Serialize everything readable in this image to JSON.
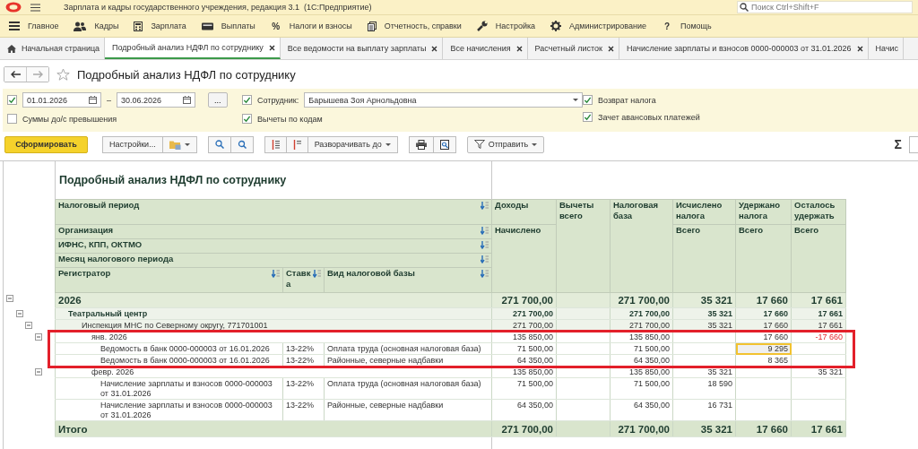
{
  "window": {
    "title": "Зарплата и кадры государственного учреждения, редакция 3.1  (1С:Предприятие)",
    "search_placeholder": "Поиск Ctrl+Shift+F"
  },
  "menu": [
    {
      "label": "Главное",
      "kind": "menu"
    },
    {
      "label": "Кадры",
      "kind": "people"
    },
    {
      "label": "Зарплата",
      "kind": "calculator"
    },
    {
      "label": "Выплаты",
      "kind": "wallet"
    },
    {
      "label": "Налоги и взносы",
      "glyph": "%"
    },
    {
      "label": "Отчетность, справки",
      "kind": "document"
    },
    {
      "label": "Настройка",
      "kind": "wrench"
    },
    {
      "label": "Администрирование",
      "kind": "gear"
    },
    {
      "label": "Помощь",
      "glyph": "?"
    }
  ],
  "tabs": [
    {
      "label": "Начальная страница",
      "kind": "home",
      "selected": false
    },
    {
      "label": "Подробный анализ НДФЛ по сотруднику",
      "kind": "closable",
      "selected": true
    },
    {
      "label": "Все ведомости на выплату зарплаты",
      "kind": "closable",
      "selected": false
    },
    {
      "label": "Все начисления",
      "kind": "closable",
      "selected": false
    },
    {
      "label": "Расчетный листок",
      "kind": "closable",
      "selected": false
    },
    {
      "label": "Начисление зарплаты и взносов 0000-000003 от 31.01.2026",
      "kind": "closable",
      "selected": false
    },
    {
      "label": "Начис",
      "kind": "cut",
      "selected": false
    }
  ],
  "form": {
    "title": "Подробный анализ НДФЛ по сотруднику"
  },
  "filters": {
    "period": {
      "checked": true,
      "date_from": "01.01.2026",
      "separator": "–",
      "date_to": "30.06.2026",
      "button": "..."
    },
    "exceed_sums": {
      "label": "Суммы до/с превышения",
      "checked": false
    },
    "employee": {
      "label": "Сотрудник:",
      "checked": true,
      "value": "Барышева Зоя Арнольдовна"
    },
    "by_codes": {
      "label": "Вычеты по кодам",
      "checked": true
    },
    "refund": {
      "label": "Возврат налога",
      "checked": true
    },
    "advance": {
      "label": "Зачет авансовых платежей",
      "checked": true
    }
  },
  "toolbar": {
    "generate": "Сформировать",
    "settings": "Настройки...",
    "expand": "Разворачивать до",
    "send": "Отправить",
    "sum": "Σ"
  },
  "report": {
    "title": "Подробный анализ НДФЛ по сотруднику",
    "group_levels": [
      "Налоговый период",
      "Организация",
      "ИФНС, КПП, ОКТМО",
      "Месяц налогового периода"
    ],
    "detail_columns": [
      "Регистратор",
      "Ставка",
      "Вид налоговой базы"
    ],
    "value_columns": [
      {
        "label": "Доходы",
        "sub": "Начислено"
      },
      {
        "label": "Вычеты всего"
      },
      {
        "label": "Налоговая база"
      },
      {
        "label": "Исчислено налога",
        "sub": "Всего"
      },
      {
        "label": "Удержано налога",
        "sub": "Всего"
      },
      {
        "label": "Осталось удержать",
        "sub": "Всего"
      }
    ],
    "rows": [
      {
        "kind": "year",
        "label": "2026",
        "expanded": true,
        "values": {
          "income": "271 700,00",
          "base": "271 700,00",
          "calculated": "35 321",
          "withheld": "17 660",
          "remaining": "17 661"
        },
        "children": [
          {
            "kind": "org",
            "label": "Театральный центр",
            "expanded": true,
            "values": {
              "income": "271 700,00",
              "base": "271 700,00",
              "calculated": "35 321",
              "withheld": "17 660",
              "remaining": "17 661"
            },
            "children": [
              {
                "kind": "ifns",
                "label": "Инспекция МНС по Северному округу, 771701001",
                "expanded": true,
                "values": {
                  "income": "271 700,00",
                  "base": "271 700,00",
                  "calculated": "35 321",
                  "withheld": "17 660",
                  "remaining": "17 661"
                },
                "children": [
                  {
                    "kind": "month",
                    "label": "янв. 2026",
                    "expanded": true,
                    "highlight_frame": true,
                    "values": {
                      "income": "135 850,00",
                      "base": "135 850,00",
                      "withheld": "17 660",
                      "remaining": {
                        "text": "-17 660",
                        "negative": true
                      }
                    },
                    "children": [
                      {
                        "kind": "doc",
                        "label": "Ведомость в банк 0000-000003 от 16.01.2026",
                        "rate": "13-22%",
                        "base_type": "Оплата труда (основная налоговая база)",
                        "values": {
                          "income": "71 500,00",
                          "base": "71 500,00",
                          "withheld": {
                            "text": "9 295",
                            "selected": true
                          }
                        }
                      },
                      {
                        "kind": "doc",
                        "label": "Ведомость в банк 0000-000003 от 16.01.2026",
                        "rate": "13-22%",
                        "base_type": "Районные, северные надбавки",
                        "values": {
                          "income": "64 350,00",
                          "base": "64 350,00",
                          "withheld": "8 365"
                        }
                      }
                    ]
                  },
                  {
                    "kind": "month",
                    "label": "февр. 2026",
                    "expanded": true,
                    "values": {
                      "income": "135 850,00",
                      "base": "135 850,00",
                      "calculated": "35 321",
                      "remaining": "35 321"
                    },
                    "children": [
                      {
                        "kind": "doc",
                        "label": "Начисление зарплаты и взносов 0000-000003 от 31.01.2026",
                        "rate": "13-22%",
                        "base_type": "Оплата труда (основная налоговая база)",
                        "values": {
                          "income": "71 500,00",
                          "base": "71 500,00",
                          "calculated": "18 590"
                        }
                      },
                      {
                        "kind": "doc",
                        "label": "Начисление зарплаты и взносов 0000-000003 от 31.01.2026",
                        "rate": "13-22%",
                        "base_type": "Районные, северные надбавки",
                        "values": {
                          "income": "64 350,00",
                          "base": "64 350,00",
                          "calculated": "16 731"
                        }
                      }
                    ]
                  }
                ]
              }
            ]
          }
        ]
      }
    ],
    "total": {
      "label": "Итого",
      "values": {
        "income": "271 700,00",
        "base": "271 700,00",
        "calculated": "35 321",
        "withheld": "17 660",
        "remaining": "17 661"
      }
    }
  }
}
